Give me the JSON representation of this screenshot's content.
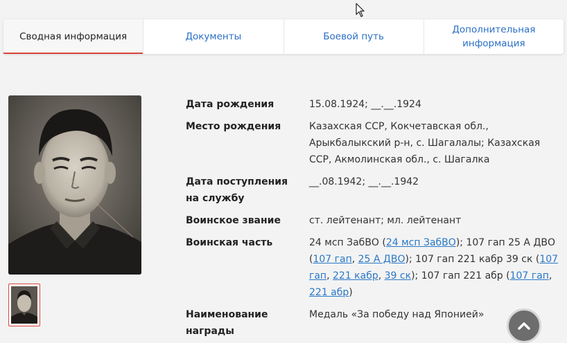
{
  "tabs": [
    {
      "label": "Сводная информация",
      "active": true
    },
    {
      "label": "Документы",
      "active": false
    },
    {
      "label": "Боевой путь",
      "active": false
    },
    {
      "label": "Дополнительная\nинформация",
      "active": false
    }
  ],
  "info": {
    "birth_date": {
      "label": "Дата рождения",
      "value": "15.08.1924; __.__.1924"
    },
    "birth_place": {
      "label": "Место рождения",
      "value": "Казахская ССР, Кокчетавская обл., Арыкбалыкский р-н, с. Шагалалы; Казахская ССР, Акмолинская обл., с. Шагалка"
    },
    "service_date": {
      "label": "Дата поступления на службу",
      "value": "__.08.1942; __.__.1942"
    },
    "rank": {
      "label": "Воинское звание",
      "value": "ст. лейтенант; мл. лейтенант"
    },
    "unit": {
      "label": "Воинская часть",
      "t1": "24 мсп ЗабВО (",
      "l1": "24 мсп ЗабВО",
      "t2": "); 107 гап 25 А ДВО (",
      "l2": "107 гап",
      "t3": ", ",
      "l3": "25 А ДВО",
      "t4": "); 107 гап 221 кабр 39 ск (",
      "l4": "107 гап",
      "t5": ", ",
      "l5": "221 кабр",
      "t6": ", ",
      "l6": "39 ск",
      "t7": "); 107 гап 221 абр (",
      "l7": "107 гап",
      "t8": ", ",
      "l8": "221 абр",
      "t9": ")"
    },
    "award": {
      "label": "Наименование награды",
      "value": "Медаль «За победу над Японией»"
    }
  },
  "colors": {
    "accent": "#d9443b",
    "link": "#2a78c6"
  },
  "icons": {
    "scroll_top": "chevron-up-icon",
    "cursor": "mouse-pointer-icon"
  }
}
